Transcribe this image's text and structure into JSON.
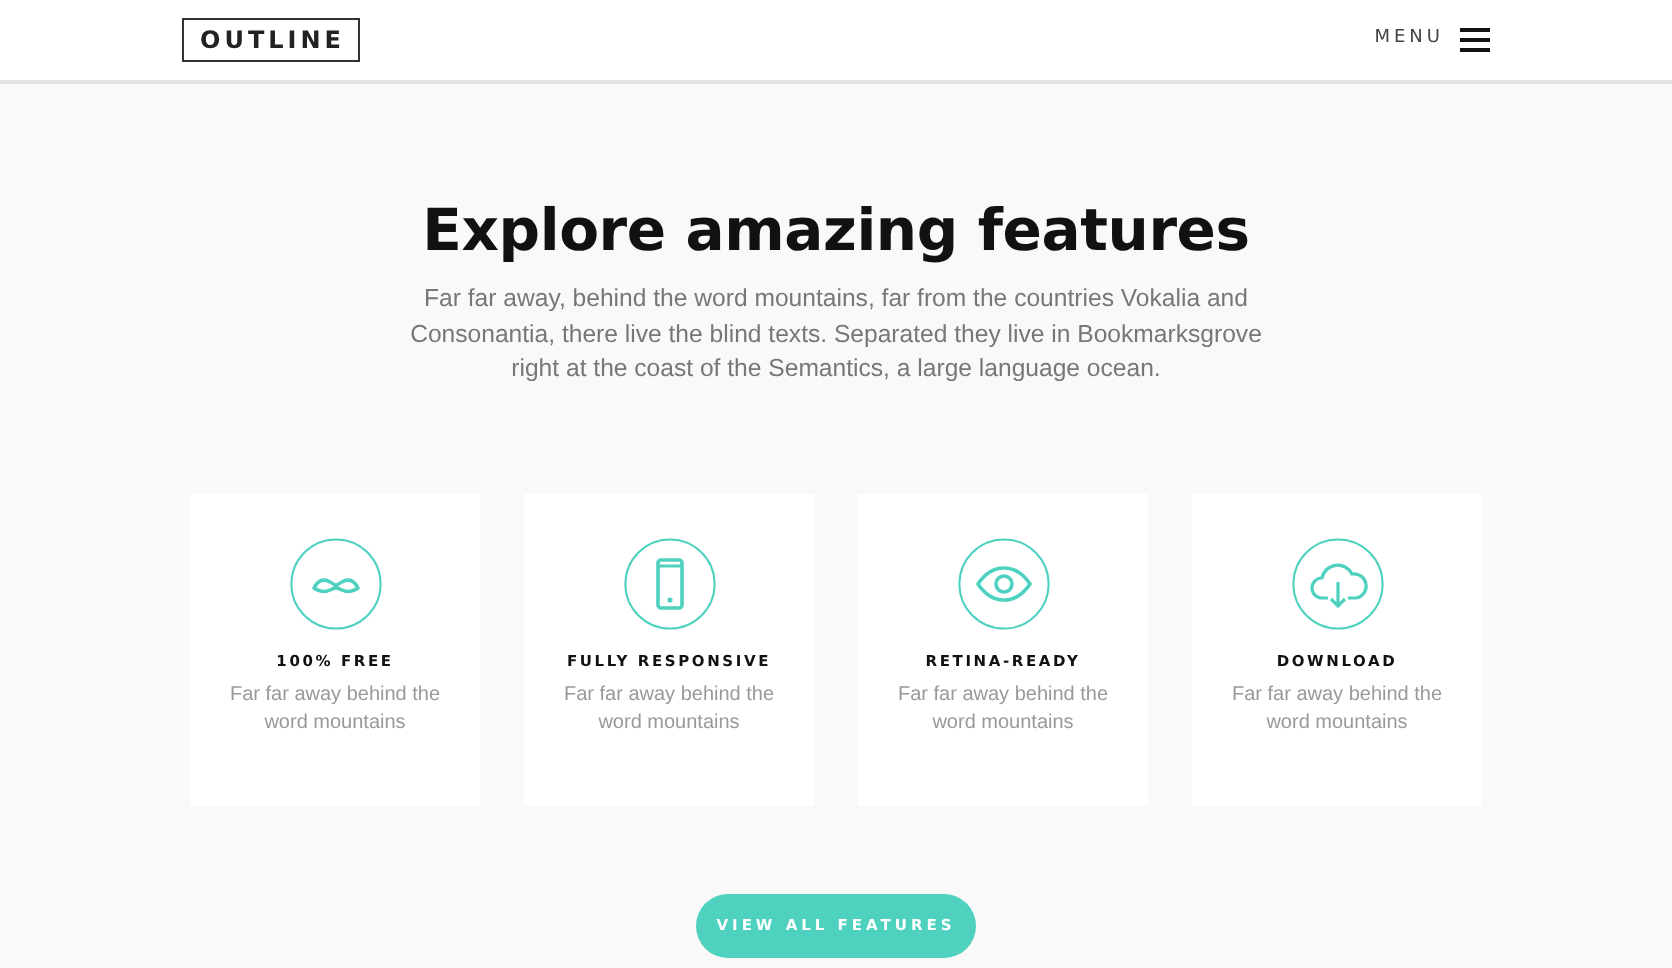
{
  "navbar": {
    "logo": "OUTLINE",
    "menu_label": "MENU"
  },
  "hero": {
    "title": "Explore amazing features",
    "text": "Far far away, behind the word mountains, far from the countries Vokalia and Consonantia, there live the blind texts. Separated they live in Bookmarksgrove right at the coast of the Semantics, a large language ocean."
  },
  "features": [
    {
      "title": "100% FREE",
      "text": "Far far away behind the word mountains"
    },
    {
      "title": "FULLY RESPONSIVE",
      "text": "Far far away behind the word mountains"
    },
    {
      "title": "RETINA-READY",
      "text": "Far far away behind the word mountains"
    },
    {
      "title": "DOWNLOAD",
      "text": "Far far away behind the word mountains"
    }
  ],
  "button": "VIEW ALL FEATURES"
}
